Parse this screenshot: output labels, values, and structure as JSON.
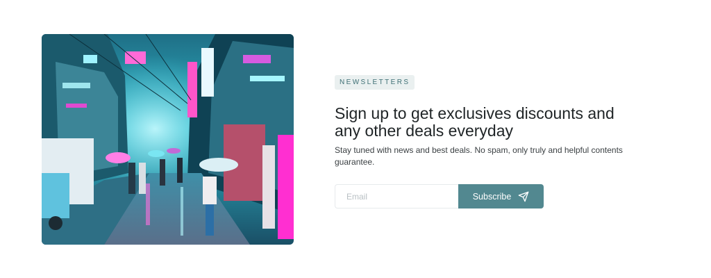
{
  "newsletter": {
    "badge": "NEWSLETTERS",
    "heading": "Sign up to get exclusives discounts and any other deals everyday",
    "description": "Stay tuned with news and best deals. No spam, only truly and helpful contents guarantee.",
    "email_placeholder": "Email",
    "subscribe_label": "Subscribe",
    "subscribe_icon": "send-icon",
    "accent_color": "#528890",
    "badge_bg_color": "#eaf0f0",
    "badge_text_color": "#3d6f74"
  },
  "image": {
    "subject": "neon-lit rainy city street with pedestrians and umbrellas"
  }
}
